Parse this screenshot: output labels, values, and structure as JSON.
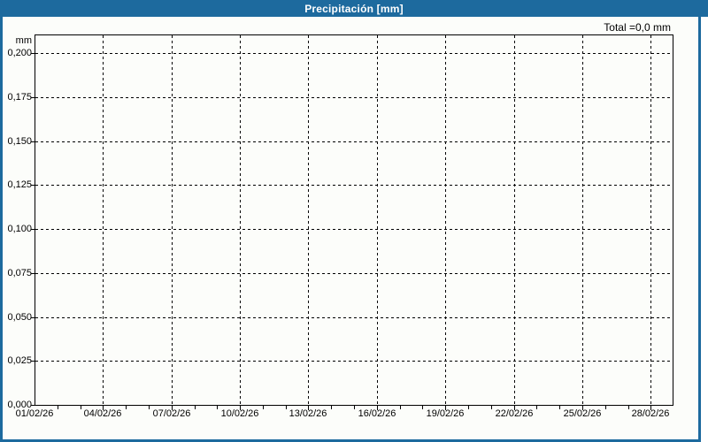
{
  "window": {
    "title": "Precipitación [mm]"
  },
  "colors": {
    "titlebar_bg": "#1d6a9e",
    "titlebar_text": "#ffffff",
    "frame_border": "#1d6a9e",
    "chart_background": "#fcfdfa",
    "grid": "#000000",
    "axis_text": "#000000"
  },
  "chart_data": {
    "type": "bar",
    "title": "Precipitación [mm]",
    "ylabel": "mm",
    "unit_label": "mm",
    "total_annotation": "Total =0,0 mm",
    "total_value_mm": 0.0,
    "grid": "dashed, both axes",
    "legend": "none",
    "x_tick_labels": [
      "01/02/26",
      "04/02/26",
      "07/02/26",
      "10/02/26",
      "13/02/26",
      "16/02/26",
      "19/02/26",
      "22/02/26",
      "25/02/26",
      "28/02/26"
    ],
    "x_label_every_days": 3,
    "x_total_days": 28,
    "y_tick_labels": [
      "0,200",
      "0,175",
      "0,150",
      "0,125",
      "0,100",
      "0,075",
      "0,050",
      "0,025",
      "0,000"
    ],
    "y_tick_values": [
      0.2,
      0.175,
      0.15,
      0.125,
      0.1,
      0.075,
      0.05,
      0.025,
      0.0
    ],
    "ylim": [
      0,
      0.21
    ],
    "series": [
      {
        "name": "Precipitación",
        "values": [],
        "note_visible_on_screen": "no bars plotted; total shown is 0,0 mm"
      }
    ]
  }
}
